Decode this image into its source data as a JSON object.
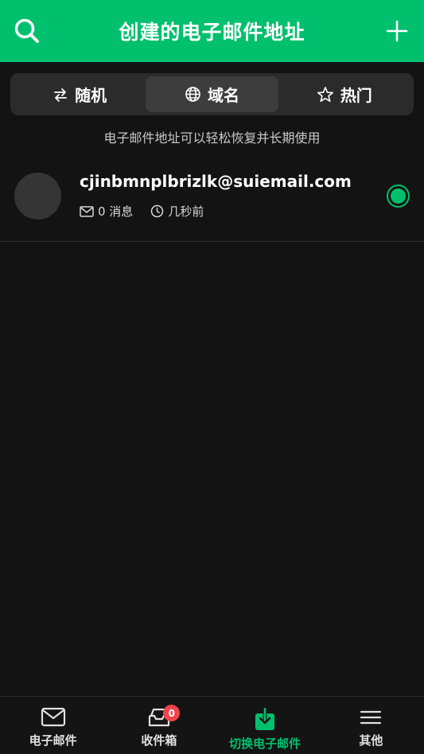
{
  "header": {
    "title": "创建的电子邮件地址",
    "search_icon": "search-icon",
    "add_icon": "plus-icon"
  },
  "tabs": [
    {
      "label": "随机",
      "icon": "swap-icon",
      "active": false
    },
    {
      "label": "域名",
      "icon": "globe-icon",
      "active": true
    },
    {
      "label": "热门",
      "icon": "star-icon",
      "active": false
    }
  ],
  "hint": "电子邮件地址可以轻松恢复并长期使用",
  "emails": [
    {
      "address": "cjinbmnplbrizlk@suiemail.com",
      "messages": "0 消息",
      "time": "几秒前",
      "selected": true
    }
  ],
  "bottom_nav": [
    {
      "label": "电子邮件",
      "icon": "mail-icon",
      "active": false
    },
    {
      "label": "收件箱",
      "icon": "inbox-icon",
      "active": false,
      "badge": "0"
    },
    {
      "label": "切换电子邮件",
      "icon": "switch-download-icon",
      "active": true
    },
    {
      "label": "其他",
      "icon": "menu-icon",
      "active": false
    }
  ],
  "colors": {
    "accent": "#00c06e",
    "background": "#131313",
    "badge": "#f0444b"
  }
}
